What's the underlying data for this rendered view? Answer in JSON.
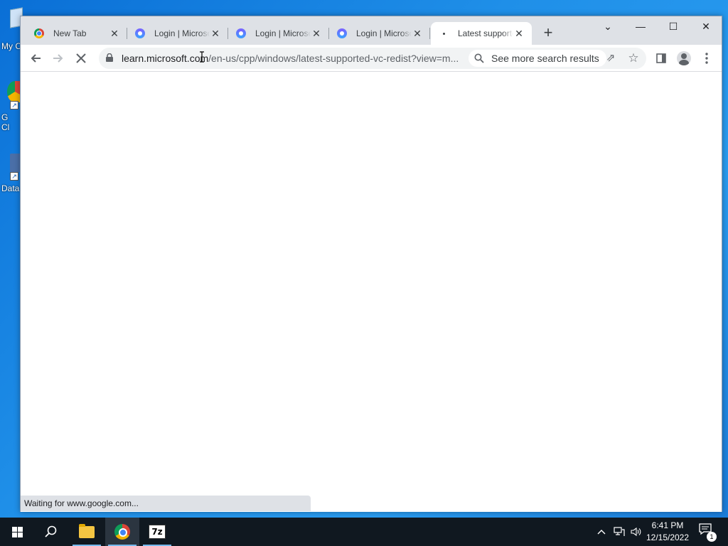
{
  "desktop": {
    "icons": [
      {
        "label": "My C"
      },
      {
        "label": "G\nCl"
      },
      {
        "label": "Data"
      }
    ]
  },
  "browser": {
    "tabs": [
      {
        "title": "New Tab",
        "icon": "chrome-icon",
        "active": false
      },
      {
        "title": "Login | Microsoft",
        "icon": "microsoft-login-icon",
        "active": false
      },
      {
        "title": "Login | Microsoft",
        "icon": "microsoft-login-icon",
        "active": false
      },
      {
        "title": "Login | Microsoft",
        "icon": "microsoft-login-icon",
        "active": false
      },
      {
        "title": "Latest supported",
        "icon": "loading-icon",
        "active": true
      }
    ],
    "new_tab_glyph": "+",
    "window_controls": {
      "tab_search": "⌄",
      "minimize": "—",
      "maximize": "☐",
      "close": "✕"
    },
    "address": {
      "domain": "learn.microsoft.com",
      "path": "/en-us/cpp/windows/latest-supported-vc-redist?view=m..."
    },
    "search_chip": "See more search results",
    "status_text": "Waiting for www.google.com..."
  },
  "taskbar": {
    "time": "6:41 PM",
    "date": "12/15/2022",
    "notification_count": "1",
    "zip_label": "7z"
  }
}
